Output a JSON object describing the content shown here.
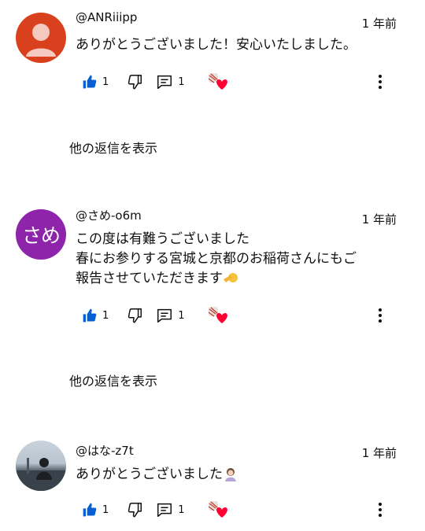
{
  "comments": [
    {
      "handle": "@ANRiiipp",
      "time": "1 年前",
      "text": "ありがとうございました！安心いたしました。",
      "likes": "1",
      "replies": "1",
      "avatar": "default-person"
    },
    {
      "handle": "@さめ-o6m",
      "time": "1 年前",
      "text": "この度は有難うございました\n春にお参りする宮城と京都のお稲荷さんにもご\n報告させていただきます",
      "likes": "1",
      "replies": "1",
      "avatar_text": "さめ"
    },
    {
      "handle": "@はな-z7t",
      "time": "1 年前",
      "text": "ありがとうございました",
      "likes": "1",
      "replies": "1",
      "avatar": "photo"
    }
  ],
  "show_replies_label": "他の返信を表示",
  "colors": {
    "like_blue": "#065fd4",
    "heart_red": "#ff0033",
    "avatar_red": "#d9411e",
    "avatar_purple": "#8e24aa"
  }
}
